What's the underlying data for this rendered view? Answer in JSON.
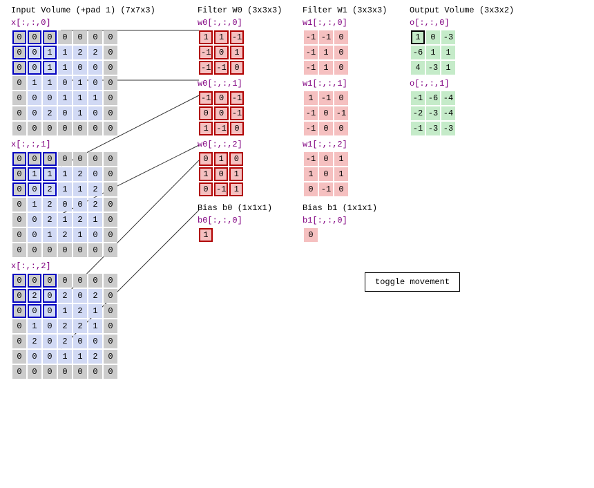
{
  "titles": {
    "input": "Input Volume (+pad 1) (7x7x3)",
    "w0": "Filter W0 (3x3x3)",
    "w1": "Filter W1 (3x3x3)",
    "out": "Output Volume (3x3x2)",
    "b0": "Bias b0 (1x1x1)",
    "b1": "Bias b1 (1x1x1)"
  },
  "labels": {
    "x0": "x[:,:,0]",
    "x1": "x[:,:,1]",
    "x2": "x[:,:,2]",
    "w00": "w0[:,:,0]",
    "w01": "w0[:,:,1]",
    "w02": "w0[:,:,2]",
    "w10": "w1[:,:,0]",
    "w11": "w1[:,:,1]",
    "w12": "w1[:,:,2]",
    "o0": "o[:,:,0]",
    "o1": "o[:,:,1]",
    "b0": "b0[:,:,0]",
    "b1": "b1[:,:,0]"
  },
  "input": {
    "x0": [
      [
        0,
        0,
        0,
        0,
        0,
        0,
        0
      ],
      [
        0,
        0,
        1,
        1,
        2,
        2,
        0
      ],
      [
        0,
        0,
        1,
        1,
        0,
        0,
        0
      ],
      [
        0,
        1,
        1,
        0,
        1,
        0,
        0
      ],
      [
        0,
        0,
        0,
        1,
        1,
        1,
        0
      ],
      [
        0,
        0,
        2,
        0,
        1,
        0,
        0
      ],
      [
        0,
        0,
        0,
        0,
        0,
        0,
        0
      ]
    ],
    "x1": [
      [
        0,
        0,
        0,
        0,
        0,
        0,
        0
      ],
      [
        0,
        1,
        1,
        1,
        2,
        0,
        0
      ],
      [
        0,
        0,
        2,
        1,
        1,
        2,
        0
      ],
      [
        0,
        1,
        2,
        0,
        0,
        2,
        0
      ],
      [
        0,
        0,
        2,
        1,
        2,
        1,
        0
      ],
      [
        0,
        0,
        1,
        2,
        1,
        0,
        0
      ],
      [
        0,
        0,
        0,
        0,
        0,
        0,
        0
      ]
    ],
    "x2": [
      [
        0,
        0,
        0,
        0,
        0,
        0,
        0
      ],
      [
        0,
        2,
        0,
        2,
        0,
        2,
        0
      ],
      [
        0,
        0,
        0,
        1,
        2,
        1,
        0
      ],
      [
        0,
        1,
        0,
        2,
        2,
        1,
        0
      ],
      [
        0,
        2,
        0,
        2,
        0,
        0,
        0
      ],
      [
        0,
        0,
        0,
        1,
        1,
        2,
        0
      ],
      [
        0,
        0,
        0,
        0,
        0,
        0,
        0
      ]
    ]
  },
  "input_sel": {
    "r0": 0,
    "r1": 2,
    "c0": 0,
    "c1": 2
  },
  "w0": {
    "d0": [
      [
        1,
        1,
        -1
      ],
      [
        -1,
        0,
        1
      ],
      [
        -1,
        -1,
        0
      ]
    ],
    "d1": [
      [
        -1,
        0,
        -1
      ],
      [
        0,
        0,
        -1
      ],
      [
        1,
        -1,
        0
      ]
    ],
    "d2": [
      [
        0,
        1,
        0
      ],
      [
        1,
        0,
        1
      ],
      [
        0,
        -1,
        1
      ]
    ]
  },
  "w1": {
    "d0": [
      [
        -1,
        -1,
        0
      ],
      [
        -1,
        1,
        0
      ],
      [
        -1,
        1,
        0
      ]
    ],
    "d1": [
      [
        1,
        -1,
        0
      ],
      [
        -1,
        0,
        -1
      ],
      [
        -1,
        0,
        0
      ]
    ],
    "d2": [
      [
        -1,
        0,
        1
      ],
      [
        1,
        0,
        1
      ],
      [
        0,
        -1,
        0
      ]
    ]
  },
  "o": {
    "d0": [
      [
        1,
        0,
        -3
      ],
      [
        -6,
        1,
        1
      ],
      [
        4,
        -3,
        1
      ]
    ],
    "d1": [
      [
        -1,
        -6,
        -4
      ],
      [
        -2,
        -3,
        -4
      ],
      [
        -1,
        -3,
        -3
      ]
    ]
  },
  "o_sel": {
    "d": 0,
    "r": 0,
    "c": 0
  },
  "b0": [
    [
      1
    ]
  ],
  "b1": [
    [
      0
    ]
  ],
  "button": {
    "toggle": "toggle movement"
  }
}
